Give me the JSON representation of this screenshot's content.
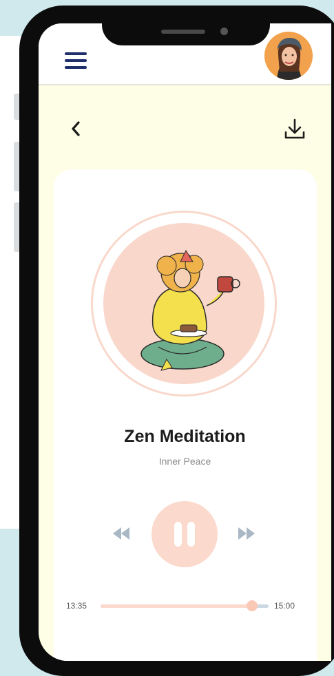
{
  "track": {
    "title": "Zen Meditation",
    "subtitle": "Inner Peace"
  },
  "player": {
    "elapsed": "13:35",
    "duration": "15:00",
    "progress_fraction": 0.9,
    "state": "playing"
  },
  "icons": {
    "menu": "hamburger-menu-icon",
    "back": "chevron-left-icon",
    "download": "download-icon",
    "rewind": "rewind-icon",
    "pause": "pause-icon",
    "forward": "fast-forward-icon"
  },
  "colors": {
    "accent": "#fbd9cc",
    "menu": "#1f2f6b",
    "screen_bg": "#fefee6",
    "track_remaining": "#ccd9e2",
    "controls": "#a9b8c4"
  }
}
